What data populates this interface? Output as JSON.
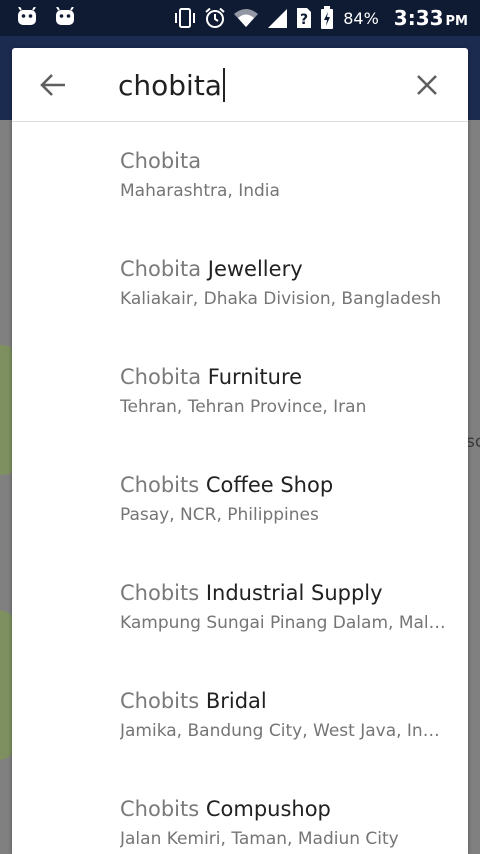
{
  "status_bar": {
    "battery": "84%",
    "time": "3:33",
    "time_suffix": "PM"
  },
  "search": {
    "query": "chobita"
  },
  "results": [
    {
      "match": "Chobita",
      "rest": "",
      "subtitle": "Maharashtra, India"
    },
    {
      "match": "Chobita",
      "rest": " Jewellery",
      "subtitle": "Kaliakair, Dhaka Division, Bangladesh"
    },
    {
      "match": "Chobita",
      "rest": " Furniture",
      "subtitle": "Tehran, Tehran Province, Iran"
    },
    {
      "match": "Chobits",
      "rest": " Coffee Shop",
      "subtitle": "Pasay, NCR, Philippines"
    },
    {
      "match": "Chobits",
      "rest": " Industrial Supply",
      "subtitle": "Kampung Sungai Pinang Dalam, Malaysia"
    },
    {
      "match": "Chobits",
      "rest": " Bridal",
      "subtitle": "Jamika, Bandung City, West Java, Indonesia"
    },
    {
      "match": "Chobits",
      "rest": " Compushop",
      "subtitle": "Jalan Kemiri, Taman, Madiun City"
    }
  ],
  "map": {
    "partial_label": "sc"
  },
  "colors": {
    "status_bar": "#0f1a33",
    "app_bar": "#1b2a4f",
    "match_text": "#7a7a7a",
    "result_text": "#212121",
    "subtitle_text": "#757575"
  },
  "icons": {
    "status_left": [
      "android-robot-icon",
      "android-robot-icon"
    ],
    "status_right": [
      "vibrate-icon",
      "alarm-icon",
      "wifi-icon",
      "signal-icon",
      "unknown-sim-icon",
      "battery-charging-icon"
    ],
    "search_left": "arrow-back-icon",
    "search_right": "close-icon"
  }
}
